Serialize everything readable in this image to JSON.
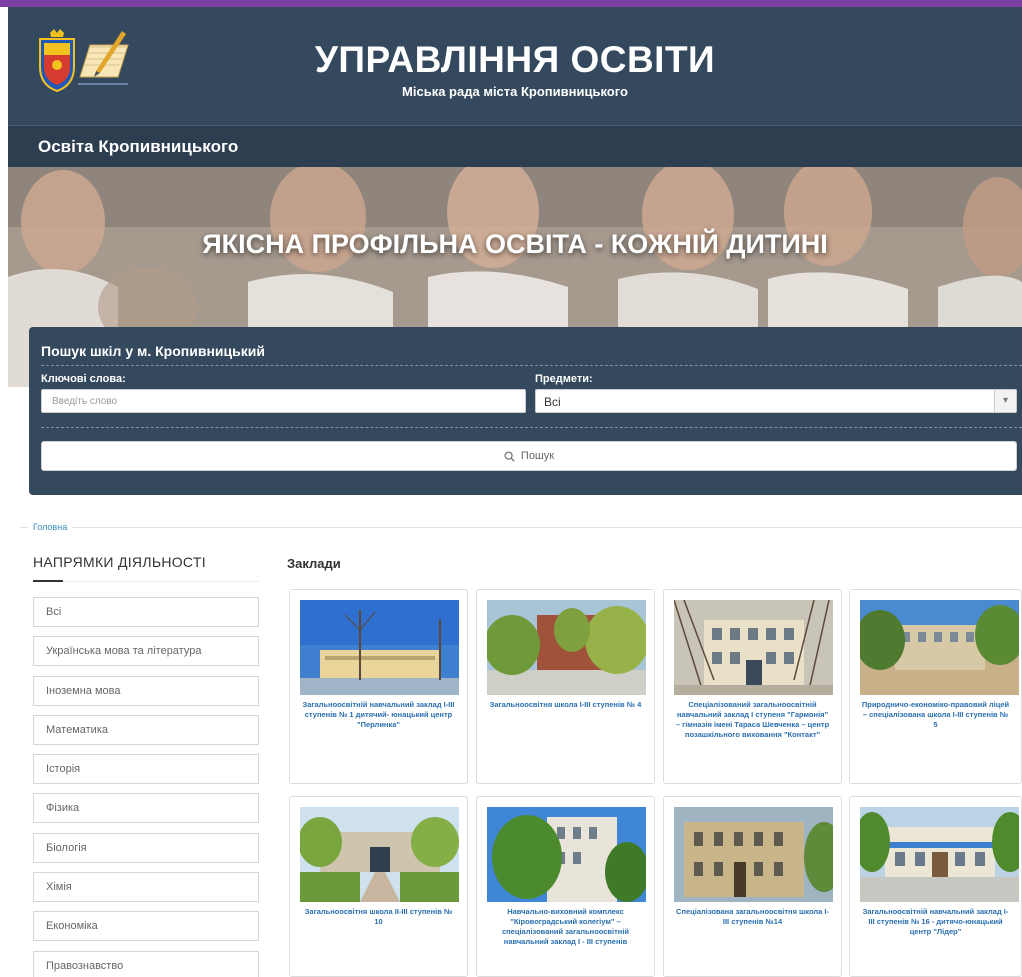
{
  "header": {
    "title": "УПРАВЛІННЯ ОСВІТИ",
    "subtitle": "Міська рада міста Кропивницького",
    "colors": {
      "stripe": "#7b3fa3",
      "header_bg": "#34495e"
    }
  },
  "subheader": {
    "title": "Освіта Кропивницького"
  },
  "hero": {
    "tagline": "ЯКІСНА ПРОФІЛЬНА ОСВІТА - КОЖНІЙ ДИТИНІ"
  },
  "search": {
    "title": "Пошук шкіл у м. Кропивницький",
    "keywords_label": "Ключові слова:",
    "keywords_placeholder": "Введіть слово",
    "subjects_label": "Предмети:",
    "subjects_value": "Всі",
    "button_label": "Пошук"
  },
  "breadcrumb": {
    "home": "Головна"
  },
  "sidebar": {
    "title": "НАПРЯМКИ ДІЯЛЬНОСТІ",
    "items": [
      "Всі",
      "Українська мова та література",
      "Іноземна мова",
      "Математика",
      "Історія",
      "Фізика",
      "Біологія",
      "Хімія",
      "Економіка",
      "Правознавство"
    ]
  },
  "main": {
    "title": "Заклади",
    "cards": [
      "Загальноосвітній навчальний заклад І-ІІІ ступенів № 1 дитячий- юнацький центр \"Перлинка\"",
      "Загальноосвітня школа І-ІІІ ступенів № 4",
      "Спеціалізований загальноосвітній навчальний заклад І ступеня \"Гармонія\" – гімназія імені Тараса Шевченка – центр позашкільного виховання \"Контакт\"",
      "Природничо-економіко-правовий ліцей – спеціалізована школа І-ІІІ ступенів № 5",
      "Загальноосвітня школа ІІ-ІІІ ступенів № 10",
      "Навчально-виховний комплекс \"Кіровоградський колегіум\" – спеціалізований загальноосвітній навчальний заклад І - ІІІ ступенів",
      "Спеціалізована загальноосвітня школа І-ІІІ ступенів №14",
      "Загальноосвітній навчальний заклад І-ІІІ ступенів № 16 - дитячо-юнацький центр \"Лідер\""
    ]
  }
}
